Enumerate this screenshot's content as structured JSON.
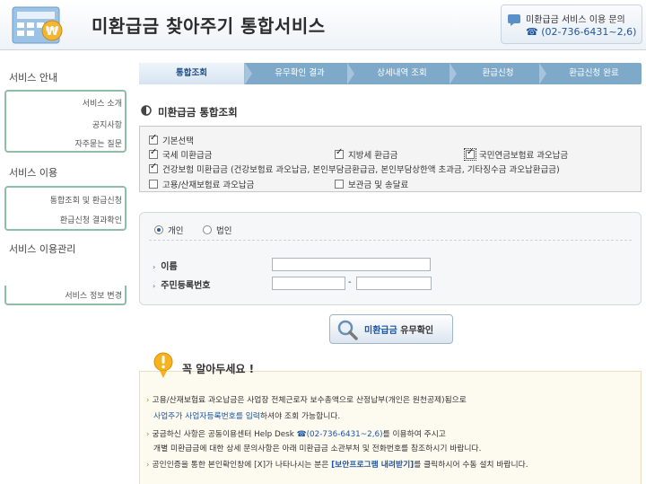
{
  "header": {
    "site_title": "미환급금 찾아주기 통합서비스",
    "inquiry_title": "미환급금 서비스 이용 문의",
    "inquiry_phone": "☎ (02-736-6431~2,6)"
  },
  "sidebar": {
    "groups": [
      {
        "heading": "서비스 안내",
        "items": [
          "서비스 소개",
          "공지사항",
          "자주묻는 질문"
        ]
      },
      {
        "heading": "서비스 이용",
        "items": [
          "통합조회 및 환급신청",
          "환급신청 결과확인"
        ]
      },
      {
        "heading": "서비스 이용관리",
        "items": [
          "서비스 정보 변경"
        ]
      }
    ]
  },
  "steps": [
    "통합조회",
    "유무확인 결과",
    "상세내역 조회",
    "환급신청",
    "환급신청 완료"
  ],
  "section_title": "미환급금 통합조회",
  "checkboxes": [
    {
      "label": "기본선택",
      "checked": true
    },
    {
      "label": "국세 미환급금",
      "checked": true
    },
    {
      "label": "지방세 환급금",
      "checked": true
    },
    {
      "label": "국민연금보험료 과오납금",
      "checked": true
    },
    {
      "label": "건강보험 미환급금 (건강보험료 과오납금, 본인부담금환급금, 본인부담상한액 초과금, 기타징수금 과오납환급금)",
      "checked": true
    },
    {
      "label": "고용/산재보험료 과오납금",
      "checked": false
    },
    {
      "label": "보관금 및 송달료",
      "checked": false
    }
  ],
  "form": {
    "radio_individual": "개인",
    "radio_corporate": "법인",
    "selected": "개인",
    "name_label": "이름",
    "id_label": "주민등록번호",
    "name_value": "",
    "id_front_value": "",
    "id_back_value": "",
    "id_separator": "-"
  },
  "button": {
    "highlight": "미환급금",
    "rest": " 유무확인"
  },
  "notice": {
    "title": "꼭 알아두세요 !",
    "lines": {
      "l1": "고용/산재보험료 과오납금은 사업장 전체근로자 보수총액으로 산정납부(개인은 원천공제)됨으로",
      "l2a": "사업주가 사업자등록번호를 입력",
      "l2b": "하셔야 조회 가능합니다.",
      "l3a": "궁금하신 사항은 공동이용센터 Help Desk ",
      "l3b": "☎(02-736-6431~2,6)",
      "l3c": "를 이용하여 주시고",
      "l4": "개별 미환급금에 대한 상세 문의사항은 아래 미환급금 소관부처 및 전화번호를 참조하시기 바랍니다.",
      "l5a": "공인인증을 통한 본인확인창에 [X]가 나타나시는 분은 ",
      "l5b": "[보안프로그램 내려받기]",
      "l5c": "를 클릭하시어 수동 설치 바랍니다."
    }
  },
  "colors": {
    "accent": "#1d56a0",
    "step_bar": "#7fa9c9",
    "sidebar_border": "#8fbea7"
  }
}
